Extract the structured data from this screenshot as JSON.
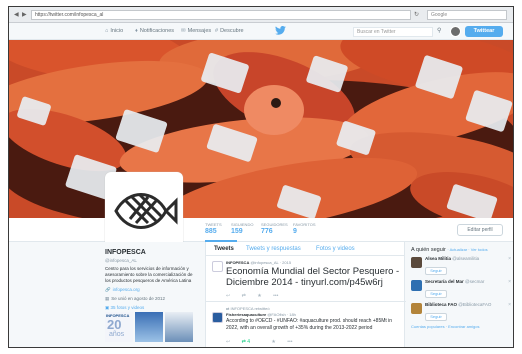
{
  "browser": {
    "url": "https://twitter.com/infopesca_al",
    "search_placeholder": "Google"
  },
  "nav": {
    "items": [
      {
        "label": "Inicio",
        "icon": "home-icon"
      },
      {
        "label": "Notificaciones",
        "icon": "bell-icon"
      },
      {
        "label": "Mensajes",
        "icon": "envelope-icon"
      },
      {
        "label": "Descubre",
        "icon": "hashtag-icon"
      }
    ],
    "search_placeholder": "Buscar en Twitter",
    "tweet_button": "Twittear"
  },
  "stats": [
    {
      "label": "Tweets",
      "value": "885"
    },
    {
      "label": "Siguiendo",
      "value": "159"
    },
    {
      "label": "Seguidores",
      "value": "776"
    },
    {
      "label": "Favoritos",
      "value": "9"
    }
  ],
  "edit_profile": "Editar perfil",
  "profile": {
    "name": "INFOPESCA",
    "handle": "@infopesca_AL",
    "bio": "Centro para los servicios de información y asesoramiento sobre la comercialización de los productos pesqueros de América Latina",
    "link": "infopesca.org",
    "joined": "Se unió en agosto de 2012",
    "photos": "35 fotos y videos",
    "logo_name": "INFOPESCA",
    "logo_years": "20",
    "logo_anos": "años"
  },
  "tabs": [
    {
      "label": "Tweets"
    },
    {
      "label": "Tweets y respuestas"
    },
    {
      "label": "Fotos y videos"
    }
  ],
  "tweets": [
    {
      "author": "INFOPESCA",
      "handle": "@infopesca_AL · 2015",
      "text": "Economía Mundial del Sector Pesquero - Diciembre 2014 - tinyurl.com/p45w6rj"
    },
    {
      "retweet_note": "INFOPESCA retwitteó",
      "author": "Fisheriesaquaculture",
      "handle": "@FAOfish · 18h",
      "text": "According to #OECD - #UNFAO: #aquaculture prod. should reach +85Mt in 2022, with an overall growth of +35% during the 2013-2022 period",
      "retweets": "4"
    }
  ],
  "who_to_follow": {
    "title": "A quién seguir",
    "refresh": "Actualizar",
    "view_all": "Ver todos",
    "follow_label": "Seguir",
    "items": [
      {
        "name": "Alsea Militia",
        "handle": "@alseamilitia"
      },
      {
        "name": "Secretaría del Mar",
        "handle": "@secmar"
      },
      {
        "name": "Biblioteca FAO",
        "handle": "@BibliotecaFAO"
      }
    ],
    "followed_by": "Seguido por Pesca y Acuic.",
    "footer": "Cuentas populares · Encontrar amigos"
  }
}
